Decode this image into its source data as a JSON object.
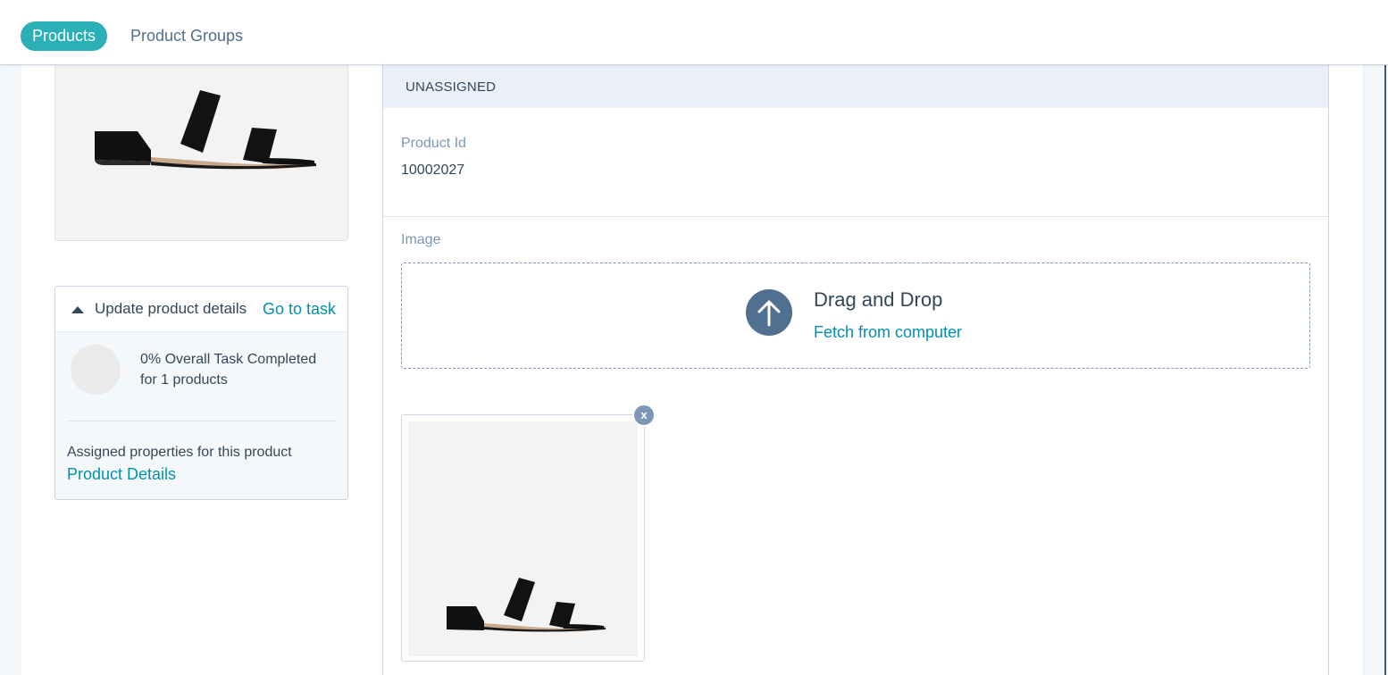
{
  "nav": {
    "tabs": [
      {
        "label": "Products",
        "active": true
      },
      {
        "label": "Product Groups",
        "active": false
      }
    ]
  },
  "task_card": {
    "title": "Update product details",
    "go_to_task": "Go to task",
    "progress_text": "0% Overall Task Completed for 1 products",
    "progress_percent": 0,
    "assigned_label": "Assigned properties for this product",
    "assigned_link": "Product Details"
  },
  "panel": {
    "header": "UNASSIGNED",
    "product_id_label": "Product Id",
    "product_id_value": "10002027",
    "image_label": "Image",
    "dropzone": {
      "title": "Drag and Drop",
      "link": "Fetch from computer"
    },
    "remove_label": "x"
  },
  "colors": {
    "accent": "#2bb0b8",
    "link": "#0091ae",
    "text": "#33475b",
    "muted": "#7c98b6"
  },
  "icons": [
    "caret-up-icon",
    "upload-arrow-icon",
    "remove-icon"
  ]
}
